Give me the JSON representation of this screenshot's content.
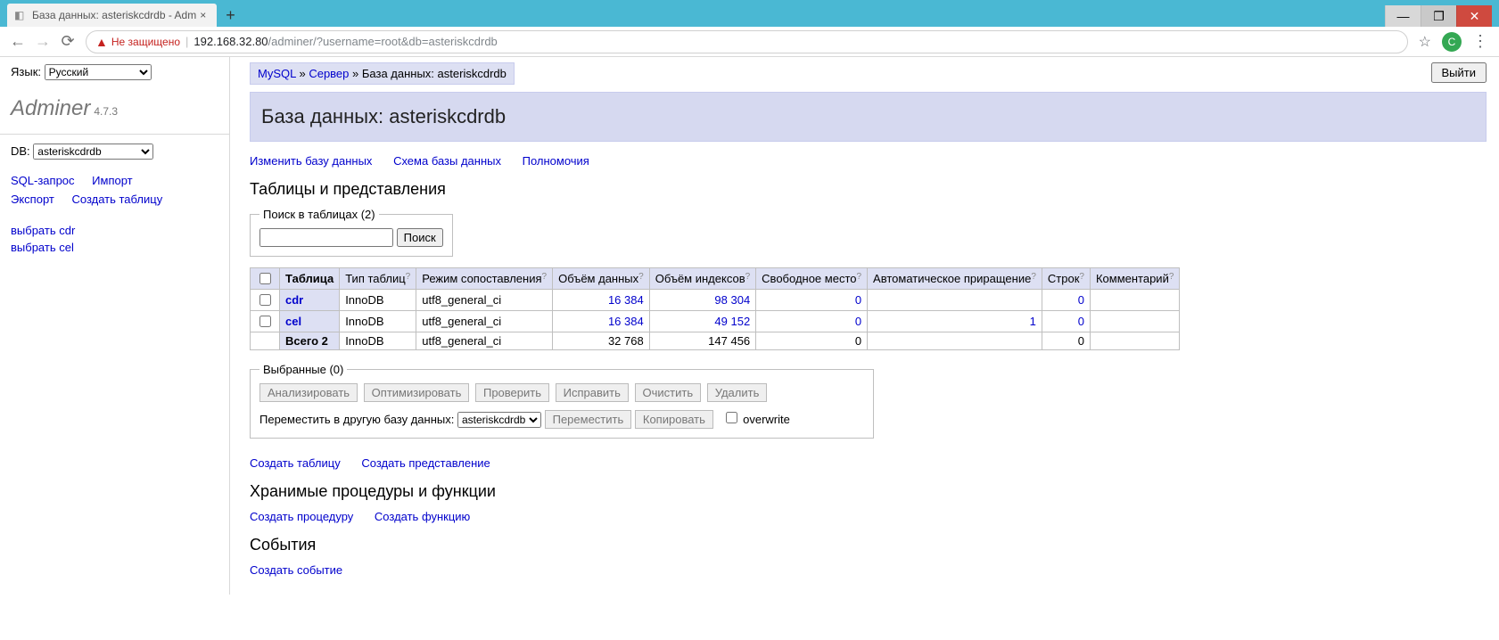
{
  "browser": {
    "tab_title": "База данных: asteriskcdrdb - Adm",
    "new_tab": "+",
    "nav": {
      "back": "←",
      "fwd": "→",
      "reload": "⟳"
    },
    "not_secure_label": "Не защищено",
    "url_host": "192.168.32.80",
    "url_path": "/adminer/?username=root&db=asteriskcdrdb",
    "star": "☆",
    "profile_letter": "C",
    "menu_dots": "⋮",
    "win": {
      "min": "—",
      "max": "❐",
      "close": "✕"
    }
  },
  "sidebar": {
    "lang_label": "Язык:",
    "lang_value": "Русский",
    "logo": "Adminer",
    "version": "4.7.3",
    "db_label": "DB:",
    "db_value": "asteriskcdrdb",
    "links": {
      "sql": "SQL-запрос",
      "import": "Импорт",
      "export": "Экспорт",
      "create_table": "Создать таблицу"
    },
    "tables": {
      "cdr": "выбрать cdr",
      "cel": "выбрать cel"
    }
  },
  "main": {
    "breadcrumb": {
      "engine": "MySQL",
      "sep": " » ",
      "server": "Сервер",
      "db_prefix": "База данных: ",
      "db": "asteriskcdrdb"
    },
    "logout_label": "Выйти",
    "title": "База данных: asteriskcdrdb",
    "top_links": {
      "alter": "Изменить базу данных",
      "schema": "Схема базы данных",
      "privs": "Полномочия"
    },
    "h3_tables": "Таблицы и представления",
    "search_fs": {
      "legend": "Поиск в таблицах (2)",
      "btn": "Поиск"
    },
    "cols": {
      "table": "Таблица",
      "engine": "Тип таблиц",
      "collation": "Режим сопоставления",
      "data": "Объём данных",
      "index": "Объём индексов",
      "free": "Свободное место",
      "ai": "Автоматическое приращение",
      "rows": "Строк",
      "comment": "Комментарий"
    },
    "rows": [
      {
        "name": "cdr",
        "engine": "InnoDB",
        "coll": "utf8_general_ci",
        "data": "16 384",
        "index": "98 304",
        "free": "0",
        "ai": "",
        "rows": "0",
        "comment": ""
      },
      {
        "name": "cel",
        "engine": "InnoDB",
        "coll": "utf8_general_ci",
        "data": "16 384",
        "index": "49 152",
        "free": "0",
        "ai": "1",
        "rows": "0",
        "comment": ""
      }
    ],
    "total": {
      "label": "Всего 2",
      "engine": "InnoDB",
      "coll": "utf8_general_ci",
      "data": "32 768",
      "index": "147 456",
      "free": "0",
      "ai": "",
      "rows": "0",
      "comment": ""
    },
    "selected_fs": {
      "legend": "Выбранные (0)",
      "btns": {
        "analyze": "Анализировать",
        "optimize": "Оптимизировать",
        "check": "Проверить",
        "repair": "Исправить",
        "truncate": "Очистить",
        "drop": "Удалить"
      },
      "move_label": "Переместить в другую базу данных:",
      "target_db": "asteriskcdrdb",
      "move_btn": "Переместить",
      "copy_btn": "Копировать",
      "overwrite": "overwrite"
    },
    "create_links": {
      "table": "Создать таблицу",
      "view": "Создать представление"
    },
    "h3_routines": "Хранимые процедуры и функции",
    "routine_links": {
      "proc": "Создать процедуру",
      "func": "Создать функцию"
    },
    "h3_events": "События",
    "event_link": "Создать событие"
  }
}
